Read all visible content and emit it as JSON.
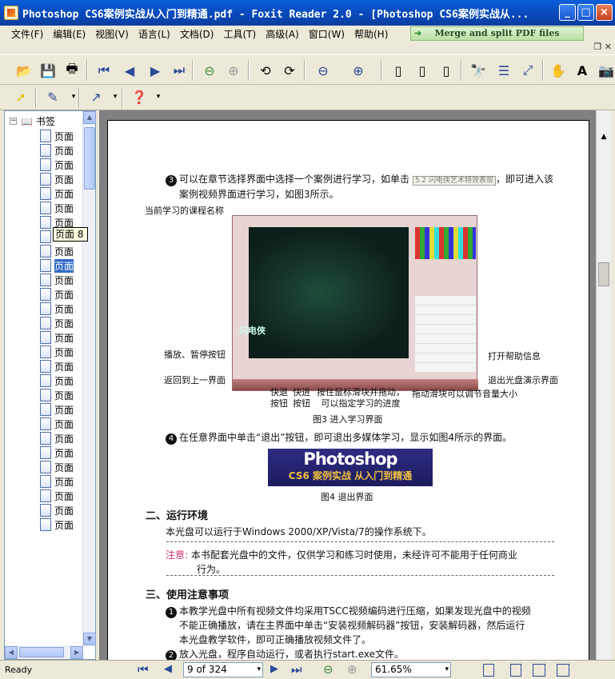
{
  "window": {
    "title": "Photoshop CS6案例实战从入门到精通.pdf - Foxit Reader 2.0 - [Photoshop CS6案例实战从..."
  },
  "menu": [
    "文件(F)",
    "编辑(E)",
    "视图(V)",
    "语言(L)",
    "文档(D)",
    "工具(T)",
    "高级(A)",
    "窗口(W)",
    "帮助(H)"
  ],
  "merge_button": "Merge and split PDF files",
  "sidebar": {
    "root_label": "书签",
    "page_label": "页面",
    "selected_index": 9,
    "tooltip": "页面 8",
    "row_count": 28
  },
  "document": {
    "step3": "可以在章节选择界面中选择一个案例进行学习，如单击",
    "step3_btn": "5.2 闪电侠艺术特效表现",
    "step3_end": "，即可进入该",
    "step3_line2": "案例视频界面进行学习，如图3所示。",
    "callouts": {
      "course_name": "当前学习的课程名称",
      "play_pause": "播放、暂停按钮",
      "back": "返回到上一界面",
      "help": "打开帮助信息",
      "exit": "退出光盘演示界面",
      "rewind": "快退\n按钮",
      "forward": "快进\n按钮",
      "drag": "按住鼠标滑块并拖动，\n可以指定学习的进度",
      "volume": "拖动滑块可以调节音量大小"
    },
    "shot_logo": "闪电侠",
    "fig3": "图3  进入学习界面",
    "step4": "在任意界面中单击“退出”按钮，即可退出多媒体学习，显示如图4所示的界面。",
    "banner_title": "Photoshop",
    "banner_sub": "CS6 案例实战 从入门到精通",
    "fig4": "图4  退出界面",
    "sec2": "二、运行环境",
    "sec2_text": "本光盘可以运行于Windows 2000/XP/Vista/7的操作系统下。",
    "note_label": "注意:",
    "note_text": "本书配套光盘中的文件，仅供学习和练习时使用，未经许可不能用于任何商业",
    "note_text2": "行为。",
    "sec3": "三、使用注意事项",
    "item1": "本教学光盘中所有视频文件均采用TSCC视频编码进行压缩，如果发现光盘中的视频",
    "item1_l2": "不能正确播放，请在主界面中单击“安装视频解码器”按钮，安装解码器，然后运行",
    "item1_l3": "本光盘教学软件，即可正确播放视频文件了。",
    "item2": "放入光盘，程序自动运行，或者执行start.exe文件。"
  },
  "status": {
    "ready": "Ready",
    "page_indicator": "9 of 324",
    "zoom": "61.65%"
  },
  "colors": {
    "title_blue": "#0a5fd8",
    "select_blue": "#316ac5",
    "note_pink": "#cc3377"
  }
}
